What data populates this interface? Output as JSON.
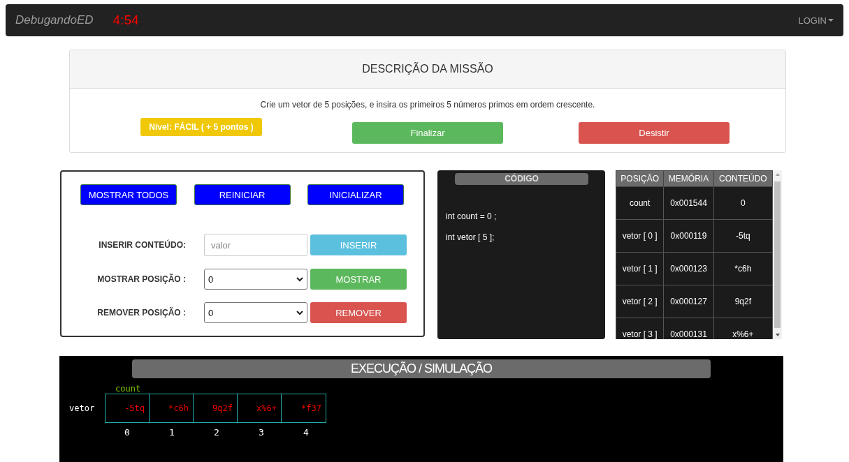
{
  "navbar": {
    "brand": "DebugandoED",
    "timer": "4:54",
    "login": "LOGIN"
  },
  "mission": {
    "title": "DESCRIÇÃO DA MISSÃO",
    "description": "Crie um vetor de 5 posições, e insira os primeiros 5 números primos em ordem crescente.",
    "level_badge": "Nível: FÁCIL ( + 5 pontos )",
    "buttons": [
      {
        "label": "Finalizar",
        "kind": "success"
      },
      {
        "label": "Desistir",
        "kind": "danger"
      }
    ]
  },
  "controls": {
    "top_buttons": [
      "MOSTRAR TODOS",
      "REINICIAR",
      "INICIALIZAR"
    ],
    "rows": [
      {
        "label": "INSERIR CONTEÚDO:",
        "kind": "input",
        "placeholder": "valor",
        "button": {
          "label": "INSERIR",
          "kind": "info"
        }
      },
      {
        "label": "MOSTRAR POSIÇÃO :",
        "kind": "select",
        "value": "0",
        "button": {
          "label": "MOSTRAR",
          "kind": "success"
        }
      },
      {
        "label": "REMOVER POSIÇÃO :",
        "kind": "select",
        "value": "0",
        "button": {
          "label": "REMOVER",
          "kind": "danger"
        }
      }
    ]
  },
  "code": {
    "title": "CÓDIGO",
    "lines": [
      "int count = 0 ;",
      "int vetor [ 5 ];"
    ]
  },
  "memory_table": {
    "columns": [
      "POSIÇÃO",
      "MEMÓRIA",
      "CONTEÚDO"
    ],
    "rows": [
      [
        "count",
        "0x001544",
        "0"
      ],
      [
        "vetor [ 0 ]",
        "0x000119",
        "-5tq"
      ],
      [
        "vetor [ 1 ]",
        "0x000123",
        "*c6h"
      ],
      [
        "vetor [ 2 ]",
        "0x000127",
        "9q2f"
      ],
      [
        "vetor [ 3 ]",
        "0x000131",
        "x%6+"
      ]
    ]
  },
  "simulation": {
    "title": "EXECUÇÃO / SIMULAÇÃO",
    "pointer_label": "count",
    "array_label": "vetor",
    "cells": [
      "-5tq",
      "*c6h",
      "9q2f",
      "x%6+",
      "*f37"
    ],
    "indices": [
      "0",
      "1",
      "2",
      "3",
      "4"
    ]
  }
}
